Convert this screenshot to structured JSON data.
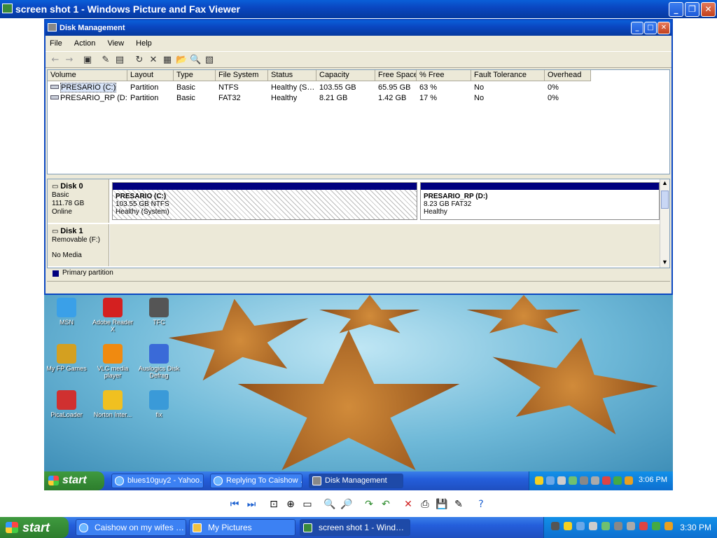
{
  "viewer": {
    "title": "screen shot 1 - Windows Picture and Fax Viewer",
    "toolbar": [
      "previous-icon",
      "next-icon",
      "best-fit-icon",
      "actual-size-icon",
      "slideshow-icon",
      "zoom-in-icon",
      "zoom-out-icon",
      "rotate-clockwise-icon",
      "rotate-counterclockwise-icon",
      "delete-icon",
      "print-icon",
      "save-icon",
      "open-editor-icon",
      "help-icon"
    ]
  },
  "dm": {
    "title": "Disk Management",
    "menu": [
      "File",
      "Action",
      "View",
      "Help"
    ],
    "columns": [
      "Volume",
      "Layout",
      "Type",
      "File System",
      "Status",
      "Capacity",
      "Free Space",
      "% Free",
      "Fault Tolerance",
      "Overhead"
    ],
    "rows": [
      [
        "PRESARIO (C:)",
        "Partition",
        "Basic",
        "NTFS",
        "Healthy (S…",
        "103.55 GB",
        "65.95 GB",
        "63 %",
        "No",
        "0%"
      ],
      [
        "PRESARIO_RP (D:)",
        "Partition",
        "Basic",
        "FAT32",
        "Healthy",
        "8.21 GB",
        "1.42 GB",
        "17 %",
        "No",
        "0%"
      ]
    ],
    "disk0": {
      "name": "Disk 0",
      "type": "Basic",
      "size": "111.78 GB",
      "state": "Online"
    },
    "part_c": {
      "name": "PRESARIO (C:)",
      "info": "103.55 GB NTFS",
      "status": "Healthy (System)"
    },
    "part_d": {
      "name": "PRESARIO_RP (D:)",
      "info": "8.23 GB FAT32",
      "status": "Healthy"
    },
    "disk1": {
      "name": "Disk 1",
      "type": "Removable (F:)",
      "state": "No Media"
    },
    "legend": "Primary partition"
  },
  "desktop_icons": [
    {
      "label": "MSN",
      "color": "#3aa0e8"
    },
    {
      "label": "Adobe Reader X",
      "color": "#d42020"
    },
    {
      "label": "TFC",
      "color": "#555555"
    },
    {
      "label": "My FP Games",
      "color": "#d4a020"
    },
    {
      "label": "VLC media player",
      "color": "#f08a10"
    },
    {
      "label": "Auslogics Disk Defrag",
      "color": "#3a6ad8"
    },
    {
      "label": "PicaLoader",
      "color": "#d03030"
    },
    {
      "label": "Norton Inter...",
      "color": "#f0c020"
    },
    {
      "label": "fix",
      "color": "#3a9ad8"
    }
  ],
  "inner_taskbar": {
    "start": "start",
    "tasks": [
      "blues10guy2 - Yahoo…",
      "Replying To Caishow …",
      "Disk Management"
    ],
    "clock": "3:06 PM"
  },
  "outer_taskbar": {
    "start": "start",
    "tasks": [
      "Caishow on my wifes …",
      "My Pictures",
      "screen shot 1 - Wind…"
    ],
    "clock": "3:30 PM"
  }
}
